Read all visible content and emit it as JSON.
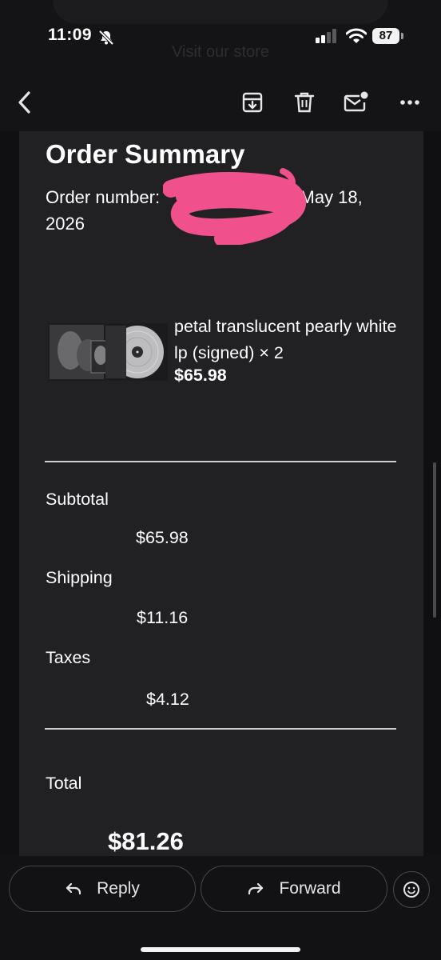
{
  "status_bar": {
    "time": "11:09",
    "battery": "87",
    "ghost_text": "Visit our store"
  },
  "toolbar": {
    "icons": [
      "back-icon",
      "archive-icon",
      "trash-icon",
      "mark-unread-icon",
      "more-icon"
    ]
  },
  "email": {
    "title": "Order Summary",
    "order_prefix": "Order number:",
    "order_suffix": "- May 18, 2026",
    "product": {
      "name": "petal translucent pearly white lp (signed) × 2",
      "price": "$65.98"
    },
    "summary": {
      "subtotal_label": "Subtotal",
      "subtotal_value": "$65.98",
      "shipping_label": "Shipping",
      "shipping_value": "$11.16",
      "taxes_label": "Taxes",
      "taxes_value": "$4.12",
      "total_label": "Total",
      "total_value": "$81.26"
    }
  },
  "actions": {
    "reply": "Reply",
    "forward": "Forward"
  },
  "colors": {
    "background": "#101012",
    "email_body": "#212124",
    "redaction": "#f0508c"
  }
}
